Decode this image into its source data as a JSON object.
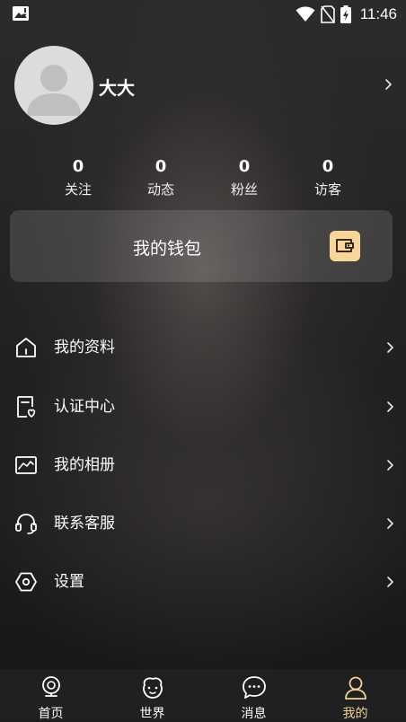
{
  "status_bar": {
    "time": "11:46",
    "icons": [
      "image-notification-icon",
      "wifi-icon",
      "no-sim-icon",
      "battery-charging-icon"
    ]
  },
  "profile": {
    "username": "大大",
    "avatar_icon": "default-avatar-icon"
  },
  "stats": [
    {
      "value": "0",
      "label": "关注"
    },
    {
      "value": "0",
      "label": "动态"
    },
    {
      "value": "0",
      "label": "粉丝"
    },
    {
      "value": "0",
      "label": "访客"
    }
  ],
  "wallet": {
    "label": "我的钱包",
    "icon": "wallet-icon",
    "icon_color": "#f9d49b"
  },
  "menu": [
    {
      "label": "我的资料",
      "icon": "home-icon"
    },
    {
      "label": "认证中心",
      "icon": "certificate-icon"
    },
    {
      "label": "我的相册",
      "icon": "album-icon"
    },
    {
      "label": "联系客服",
      "icon": "headset-icon"
    },
    {
      "label": "设置",
      "icon": "settings-hexagon-icon"
    }
  ],
  "tabs": [
    {
      "label": "首页",
      "icon": "home-pin-icon",
      "active": false
    },
    {
      "label": "世界",
      "icon": "world-face-icon",
      "active": false
    },
    {
      "label": "消息",
      "icon": "chat-bubble-icon",
      "active": false
    },
    {
      "label": "我的",
      "icon": "person-icon",
      "active": true
    }
  ],
  "colors": {
    "active_tab": "#f3d29a",
    "wallet_icon": "#f9d49b"
  }
}
